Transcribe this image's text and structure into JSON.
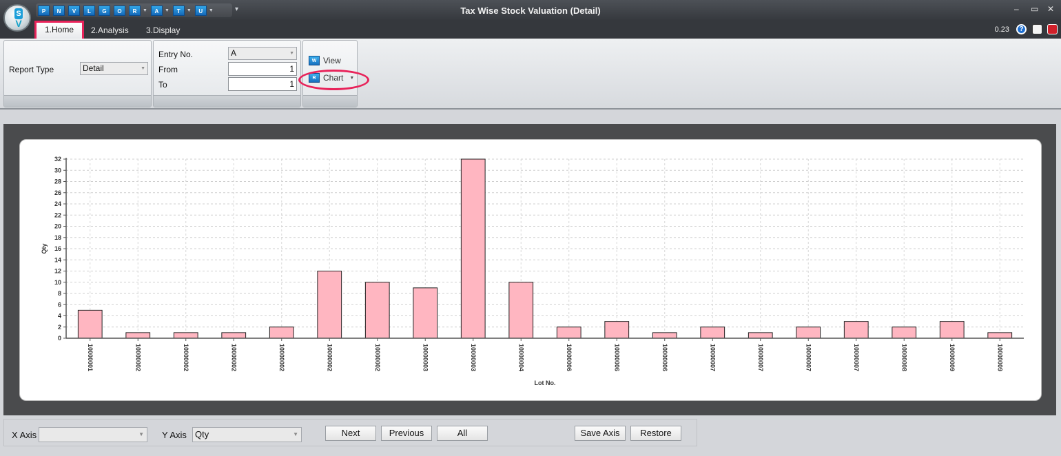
{
  "window": {
    "title": "Tax Wise Stock Valuation (Detail)",
    "minimize": "–",
    "maximize": "▭",
    "close": "✕",
    "version": "0.23"
  },
  "app_logo": {
    "letter": "S",
    "mark": "V"
  },
  "quick_access": [
    {
      "label": "P"
    },
    {
      "label": "N"
    },
    {
      "label": "V"
    },
    {
      "label": "L"
    },
    {
      "label": "G"
    },
    {
      "label": "O"
    },
    {
      "label": "R",
      "dropdown": true
    },
    {
      "label": "A",
      "dropdown": true
    },
    {
      "label": "T",
      "dropdown": true
    },
    {
      "label": "U",
      "dropdown": true
    }
  ],
  "tabs": [
    {
      "label": "1.Home",
      "active": true
    },
    {
      "label": "2.Analysis"
    },
    {
      "label": "3.Display"
    }
  ],
  "ribbon": {
    "report_type_label": "Report Type",
    "report_type_value": "Detail",
    "entry_no_label": "Entry No.",
    "entry_no_value": "A",
    "from_label": "From",
    "from_value": "1",
    "to_label": "To",
    "to_value": "1",
    "view_label": "View",
    "view_icon": "W",
    "chart_label": "Chart",
    "chart_icon": "R"
  },
  "chart_data": {
    "type": "bar",
    "xlabel": "Lot No.",
    "ylabel": "Qty",
    "ylim": [
      0,
      32
    ],
    "ytick_step": 2,
    "grid": true,
    "bar_color": "#ffb6c1",
    "categories": [
      "10000001",
      "10000002",
      "10000002",
      "10000002",
      "10000002",
      "10000002",
      "10000002",
      "10000003",
      "10000003",
      "10000004",
      "10000006",
      "10000006",
      "10000006",
      "10000007",
      "10000007",
      "10000007",
      "10000007",
      "10000008",
      "10000009",
      "10000009"
    ],
    "values": [
      5,
      1,
      1,
      1,
      2,
      12,
      10,
      9,
      32,
      10,
      2,
      3,
      1,
      2,
      1,
      2,
      3,
      2,
      3,
      1
    ]
  },
  "bottom": {
    "x_axis_label": "X Axis",
    "x_axis_value": "",
    "y_axis_label": "Y Axis",
    "y_axis_value": "Qty",
    "next": "Next",
    "previous": "Previous",
    "all": "All",
    "save_axis": "Save Axis",
    "restore": "Restore"
  }
}
